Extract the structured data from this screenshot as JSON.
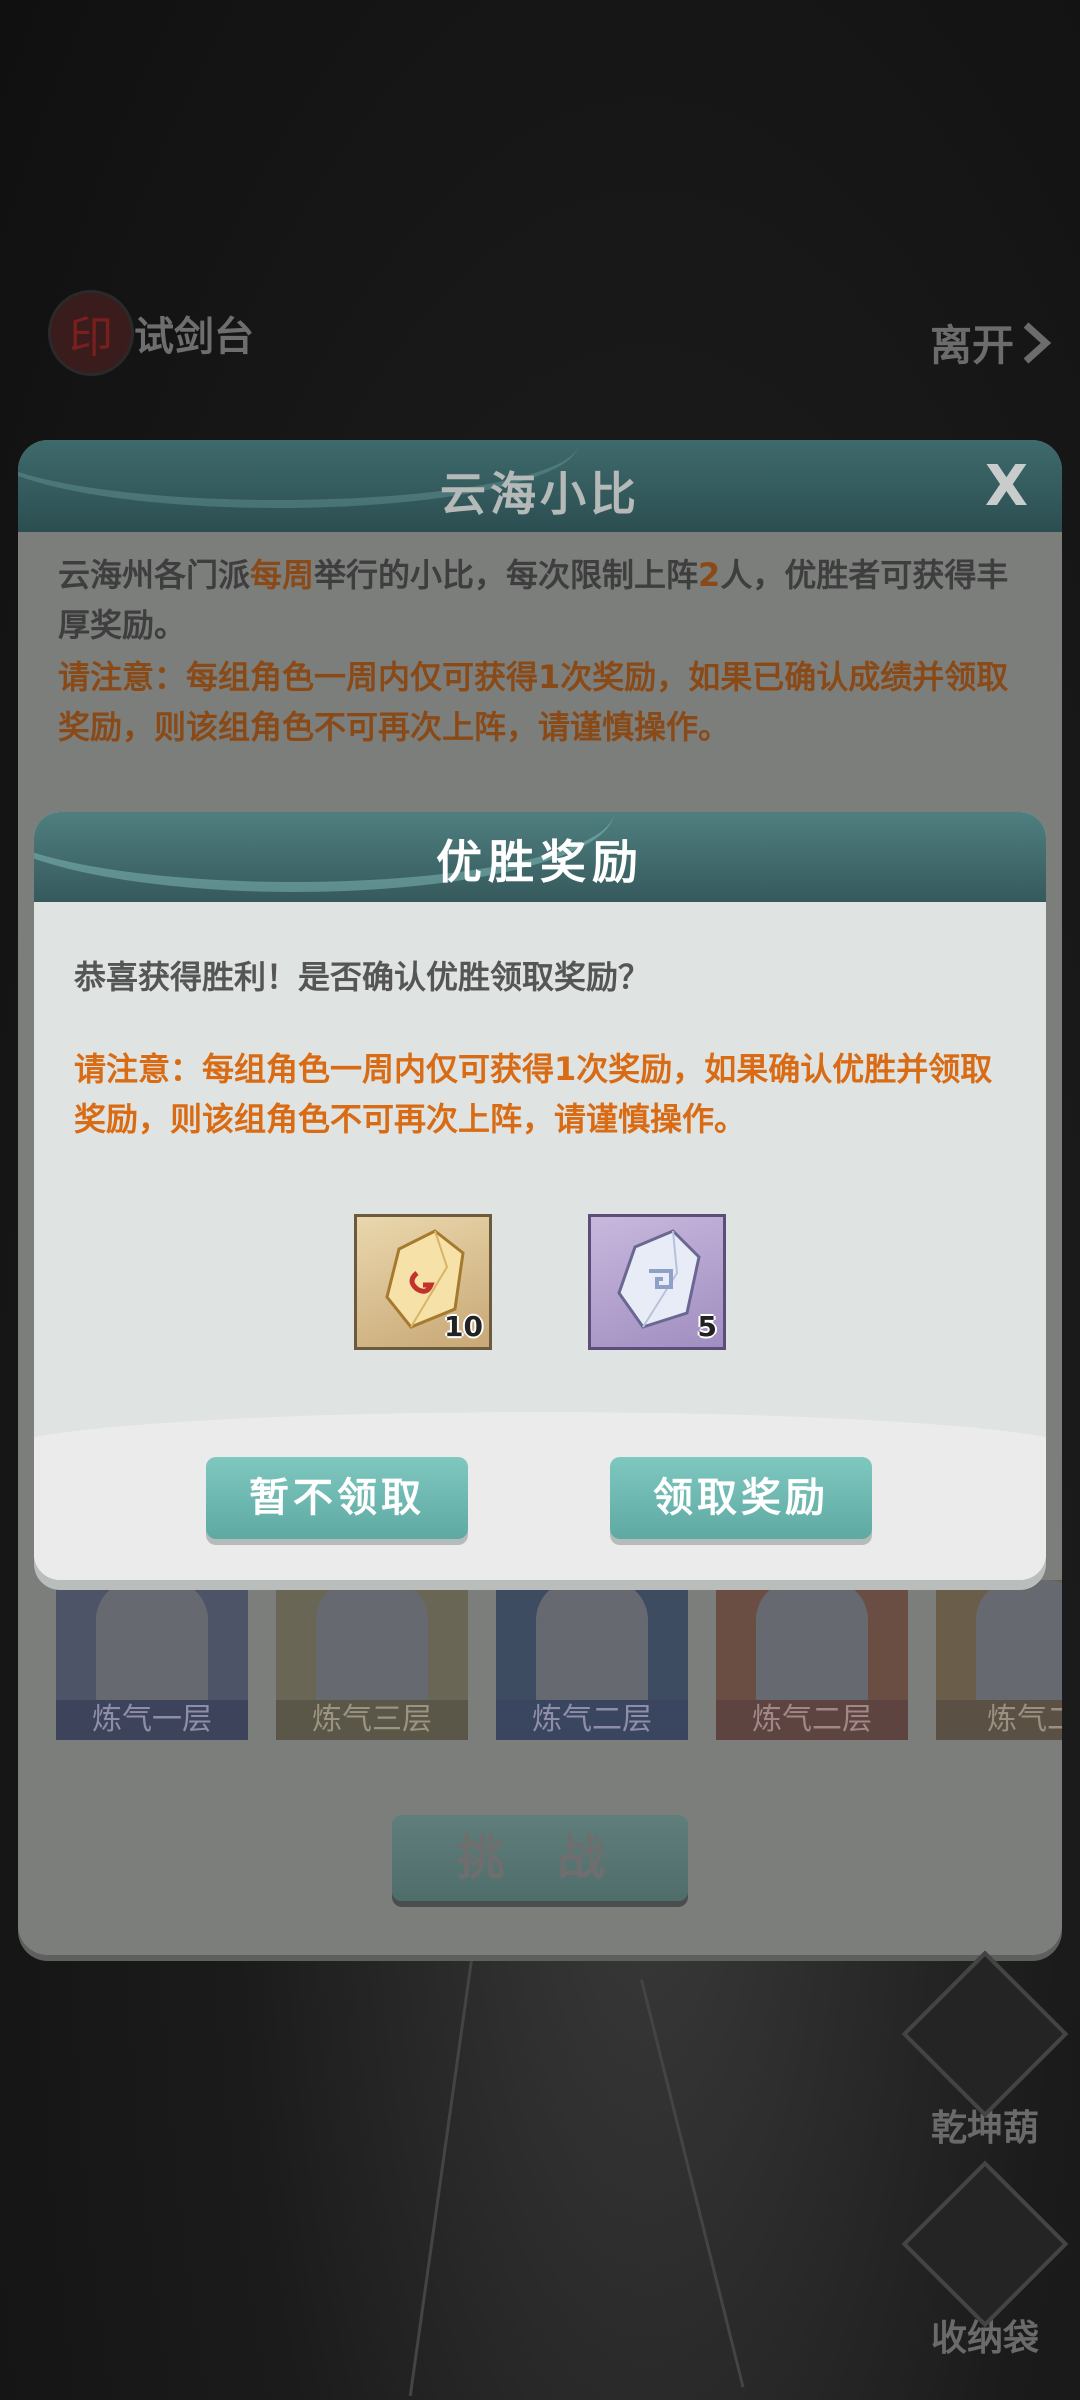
{
  "header": {
    "title": "试剑台",
    "leave_label": "离开"
  },
  "panel": {
    "title": "云海小比",
    "close_label": "X",
    "intro_part1": "云海州各门派",
    "intro_highlight1": "每周",
    "intro_part2": "举行的小比，每次限制上阵",
    "intro_highlight2": "2",
    "intro_part3": "人，优胜者可获得丰厚奖励。",
    "note": "请注意：每组角色一周内仅可获得1次奖励，如果已确认成绩并领取奖励，则该组角色不可再次上阵，请谨慎操作。",
    "roster": [
      {
        "rank": "炼气一层"
      },
      {
        "rank": "炼气三层"
      },
      {
        "rank": "炼气二层"
      },
      {
        "rank": "炼气二层"
      },
      {
        "rank": "炼气二"
      }
    ],
    "challenge_label": "挑 战"
  },
  "side": {
    "gourd_label": "乾坤葫",
    "bag_label": "收纳袋"
  },
  "modal": {
    "title": "优胜奖励",
    "message": "恭喜获得胜利！是否确认优胜领取奖励？",
    "warning": "请注意：每组角色一周内仅可获得1次奖励，如果确认优胜并领取奖励，则该组角色不可再次上阵，请谨慎操作。",
    "rewards": [
      {
        "icon": "gold-spirit-stone-icon",
        "quantity": "10"
      },
      {
        "icon": "silver-spirit-stone-icon",
        "quantity": "5"
      }
    ],
    "decline_label": "暂不领取",
    "confirm_label": "领取奖励"
  }
}
